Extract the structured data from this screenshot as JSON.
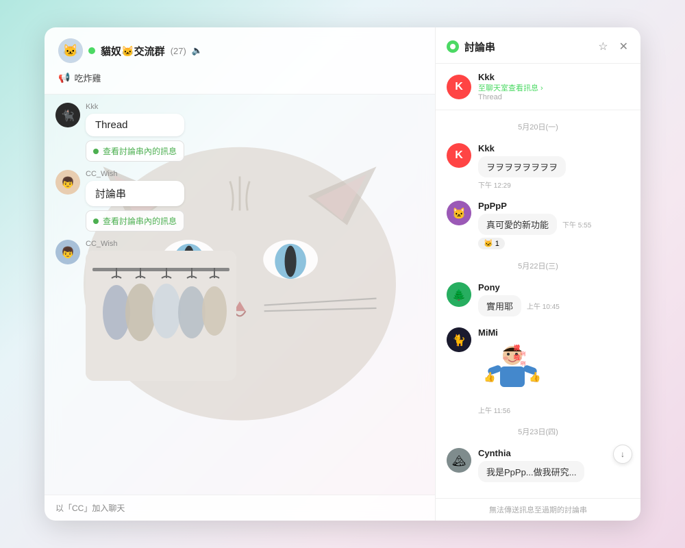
{
  "app": {
    "bg_gradient": "linear-gradient(135deg, #b2e8e0 0%, #e8f4f8 30%, #f5e8f0 70%, #f0d8e8 100%)"
  },
  "chat": {
    "group_name": "貓奴🐱交流群",
    "member_count": "(27)",
    "pinned_text": "吃炸雞",
    "messages": [
      {
        "id": "msg1",
        "username": "Kkk",
        "avatar_type": "cat_black",
        "bubble": "Thread",
        "has_thread": true,
        "thread_label": "查看討論串內的訊息"
      },
      {
        "id": "msg2",
        "username": "CC_Wish",
        "avatar_type": "cc_wish",
        "bubble": "討論串",
        "has_thread": true,
        "thread_label": "查看討論串內的訊息"
      },
      {
        "id": "msg3",
        "username": "CC_Wish",
        "avatar_type": "cc_wish2",
        "has_image": true
      }
    ],
    "footer": "以「CC」加入聊天"
  },
  "thread_panel": {
    "title": "討論串",
    "origin_user": "Kkk",
    "origin_link": "至聊天室查看訊息 ›",
    "origin_sublabel": "Thread",
    "date1": "5月20日(一)",
    "date2": "5月22日(三)",
    "date3": "5月23日(四)",
    "messages": [
      {
        "id": "tmsg1",
        "username": "Kkk",
        "avatar_type": "red",
        "text": "ヲヲヲヲヲヲヲヲ",
        "time": "下午 12:29"
      },
      {
        "id": "tmsg2",
        "username": "PpPpP",
        "avatar_type": "purple",
        "text": "真可愛的新功能",
        "time": "下午 5:55",
        "reaction": "🐱 1"
      },
      {
        "id": "tmsg3",
        "username": "Pony",
        "avatar_type": "green",
        "text": "實用耶",
        "time": "上午 10:45"
      },
      {
        "id": "tmsg4",
        "username": "MiMi",
        "avatar_type": "dark",
        "has_sticker": true,
        "time": "上午 11:56"
      },
      {
        "id": "tmsg5",
        "username": "Cynthia",
        "avatar_type": "mountain",
        "text": "我是PpPp...做我研究...",
        "time": ""
      }
    ],
    "footer": "無法傳送訊息至過期的討論串"
  }
}
